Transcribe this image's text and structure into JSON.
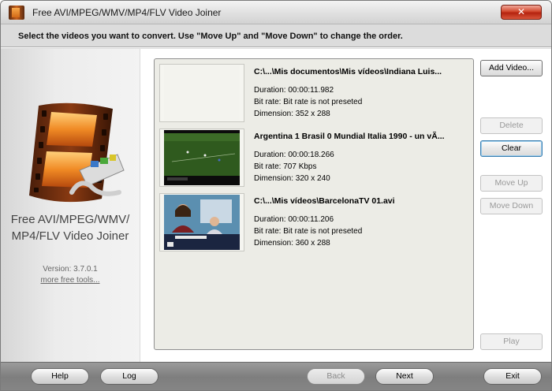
{
  "window": {
    "title": "Free AVI/MPEG/WMV/MP4/FLV Video Joiner",
    "close_label": "✕"
  },
  "instruction": "Select the videos you want to convert. Use \"Move Up\" and \"Move Down\" to change the order.",
  "sidebar": {
    "product_line1": "Free AVI/MPEG/WMV/",
    "product_line2": "MP4/FLV Video Joiner",
    "version": "Version: 3.7.0.1",
    "more_tools": "more free tools..."
  },
  "videos": [
    {
      "title": "C:\\...\\Mis documentos\\Mis vídeos\\Indiana Luis...",
      "duration": "Duration: 00:00:11.982",
      "bitrate": "Bit rate: Bit rate is not preseted",
      "dimension": "Dimension: 352 x 288",
      "thumbnail": "blank"
    },
    {
      "title": "Argentina 1 Brasil 0 Mundial Italia 1990 - un vÃ...",
      "duration": "Duration: 00:00:18.266",
      "bitrate": "Bit rate: 707 Kbps",
      "dimension": "Dimension: 320 x 240",
      "thumbnail": "soccer-field"
    },
    {
      "title": "C:\\...\\Mis vídeos\\BarcelonaTV 01.avi",
      "duration": "Duration: 00:00:11.206",
      "bitrate": "Bit rate: Bit rate is not preseted",
      "dimension": "Dimension: 360 x 288",
      "thumbnail": "tv-presenter"
    }
  ],
  "buttons": {
    "add_video": "Add Video...",
    "delete": "Delete",
    "clear": "Clear",
    "move_up": "Move Up",
    "move_down": "Move Down",
    "play": "Play"
  },
  "footer": {
    "help": "Help",
    "log": "Log",
    "back": "Back",
    "next": "Next",
    "exit": "Exit"
  }
}
